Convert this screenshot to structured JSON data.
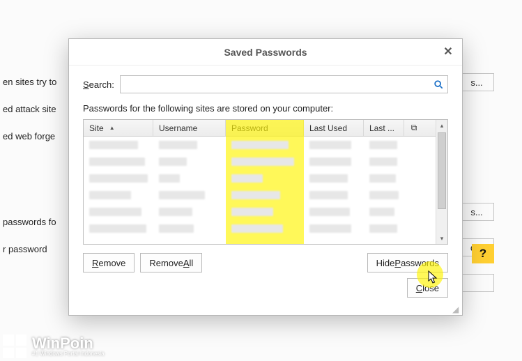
{
  "background": {
    "line1": "en sites try to",
    "line2": "ed attack site",
    "line3": "ed web forge",
    "line4": "passwords fo",
    "line5": "r password",
    "btn_s": "s...",
    "btn_s2": "s...",
    "btn_d": "d...",
    "help": "?"
  },
  "dialog": {
    "title": "Saved Passwords",
    "search_label_pre": "S",
    "search_label_post": "earch:",
    "search_value": "",
    "desc": "Passwords for the following sites are stored on your computer:",
    "columns": {
      "site": "Site",
      "username": "Username",
      "password": "Password",
      "last_used": "Last Used",
      "last_changed": "Last ...",
      "picker": "⧉"
    },
    "buttons": {
      "remove": "Remove",
      "remove_all": "Remove All",
      "hide_passwords": "Hide Passwords",
      "close": "Close"
    },
    "mnemonics": {
      "remove": "R",
      "remove_all": "A",
      "hide_passwords": "P",
      "close": "C"
    }
  },
  "watermark": {
    "title": "WinPoin",
    "subtitle": "#1 Windows Portal Indonesia"
  }
}
